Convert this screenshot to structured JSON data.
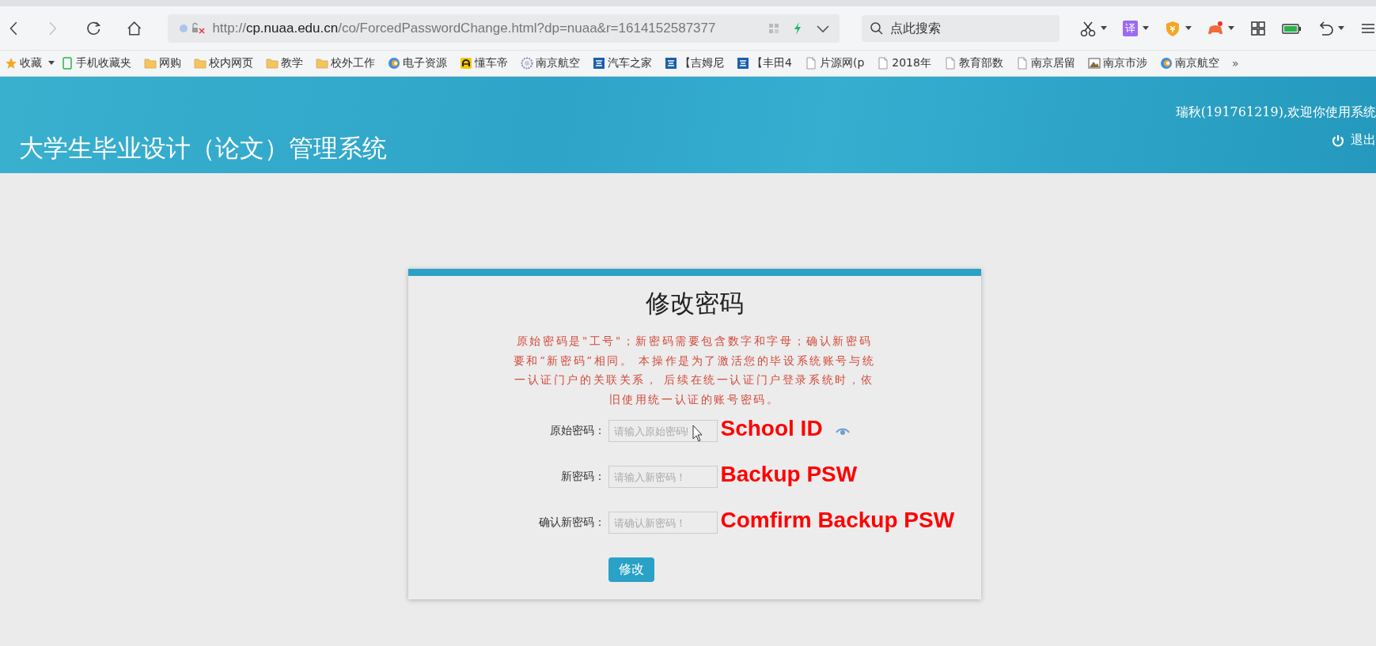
{
  "browser": {
    "nav": [
      {
        "kind": "back",
        "disabled": false
      },
      {
        "kind": "forward",
        "disabled": true
      },
      {
        "kind": "reload",
        "disabled": false
      },
      {
        "kind": "home",
        "disabled": false
      }
    ],
    "address": "http://**cp.nuaa.edu.cn**/co/ForcedPasswordChange.html?dp=nuaa&r=1614152587377",
    "search": {
      "placeholder": "点此搜索"
    },
    "toolbar": [
      {
        "kind": "scissors"
      },
      {
        "kind": "translate",
        "label": "译"
      },
      {
        "kind": "shield"
      },
      {
        "kind": "gamepad"
      },
      {
        "kind": "grid"
      },
      {
        "kind": "battery"
      },
      {
        "kind": "undo"
      },
      {
        "kind": "menu"
      }
    ],
    "bookmarks": [
      {
        "kind": "star",
        "label": "收藏"
      },
      {
        "kind": "caret"
      },
      {
        "kind": "phone",
        "label": "手机收藏夹"
      },
      {
        "kind": "folder",
        "label": "网购"
      },
      {
        "kind": "folder",
        "label": "校内网页"
      },
      {
        "kind": "folder",
        "label": "教学"
      },
      {
        "kind": "folder",
        "label": "校外工作"
      },
      {
        "kind": "globe",
        "label": "电子资源"
      },
      {
        "kind": "badge",
        "label": "懂车帝"
      },
      {
        "kind": "gear",
        "label": "南京航空"
      },
      {
        "kind": "square",
        "label": "汽车之家"
      },
      {
        "kind": "square",
        "label": "【吉姆尼"
      },
      {
        "kind": "square",
        "label": "【丰田4"
      },
      {
        "kind": "page",
        "label": "片源网(p"
      },
      {
        "kind": "page",
        "label": "2018年"
      },
      {
        "kind": "page",
        "label": "教育部数"
      },
      {
        "kind": "page",
        "label": "南京居留"
      },
      {
        "kind": "photo",
        "label": "南京市涉"
      },
      {
        "kind": "globe",
        "label": "南京航空"
      },
      {
        "kind": "more",
        "label": "»"
      }
    ]
  },
  "header": {
    "title": "大学生毕业设计（论文）管理系统",
    "greeting": "瑞秋(191761219),欢迎你使用系统",
    "logout": "退出"
  },
  "card": {
    "title": "修改密码",
    "notice": "原始密码是\"工号\"；新密码需要包含数字和字母；确认新密码要和“新密码”相同。 本操作是为了激活您的毕设系统账号与统一认证门户的关联关系， 后续在统一认证门户登录系统时，依旧使用统一认证的账号密码。",
    "fields": [
      {
        "label": "原始密码：",
        "placeholder": "请输入原始密码!",
        "annotation": "School ID"
      },
      {
        "label": "新密码：",
        "placeholder": "请输入新密码！",
        "annotation": "Backup PSW"
      },
      {
        "label": "确认新密码：",
        "placeholder": "请确认新密码！",
        "annotation": "Comfirm Backup PSW"
      }
    ],
    "submit": "修改"
  }
}
